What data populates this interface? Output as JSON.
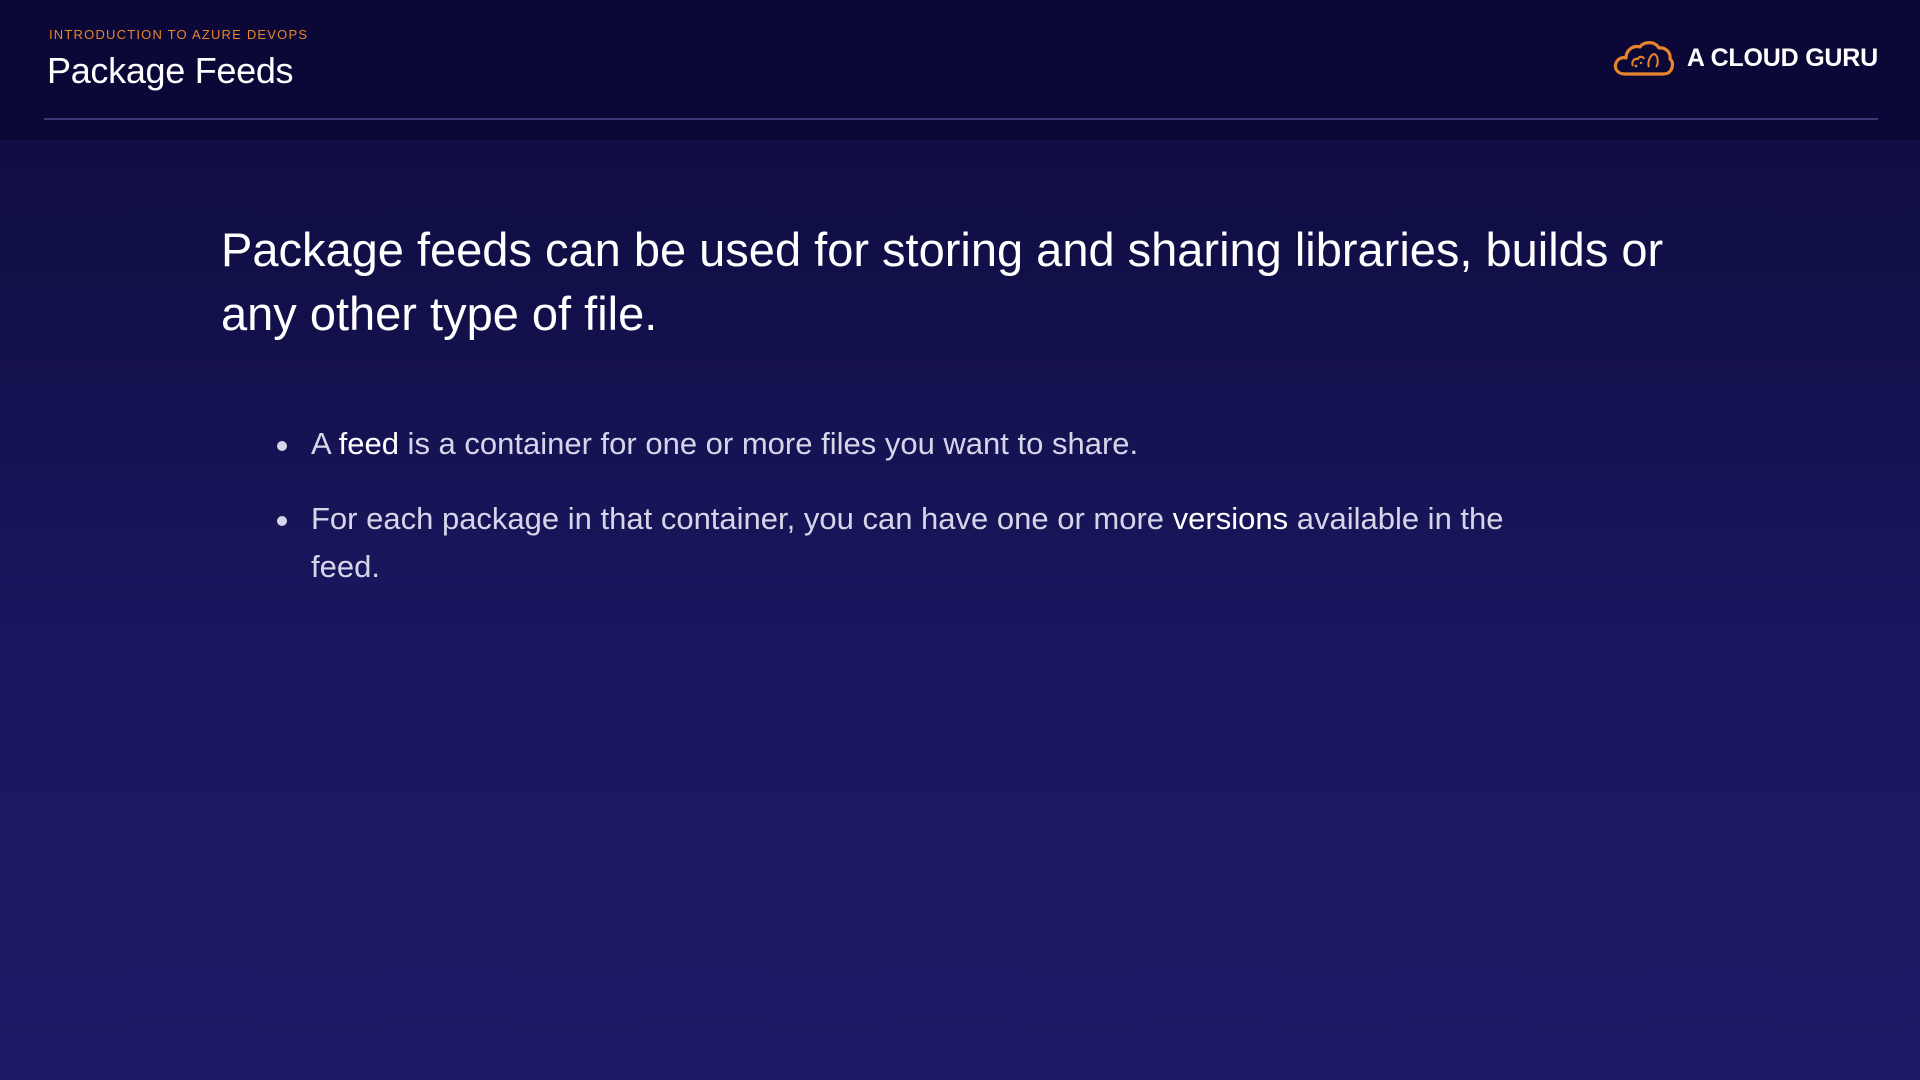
{
  "header": {
    "eyebrow": "INTRODUCTION TO AZURE DEVOPS",
    "title": "Package Feeds",
    "brand": {
      "name": "A CLOUD GURU",
      "icon": "cloud-logo-icon",
      "accent_color": "#e8842a"
    }
  },
  "main": {
    "lead": "Package feeds can be used for storing and sharing libraries, builds or any other type of file.",
    "bullets": [
      {
        "before": "A ",
        "highlight": "feed",
        "after": " is a container for one or more files you want to share."
      },
      {
        "before": "For each package in that container, you can have one or more ",
        "highlight": "versions",
        "after": " available in the feed."
      }
    ]
  },
  "colors": {
    "background_top": "#0c0a3a",
    "background_bottom": "#1e1966",
    "eyebrow": "#e8842a",
    "body_text": "#d6d6ea"
  }
}
